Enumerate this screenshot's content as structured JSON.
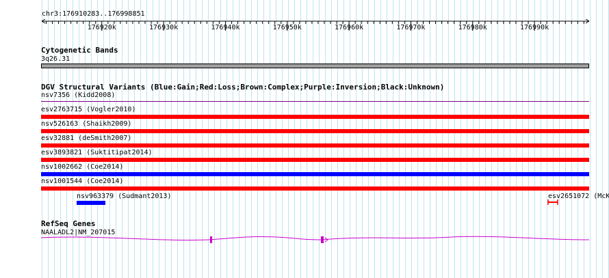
{
  "region": {
    "label": "chr3:176910283..176998851",
    "start": 176910283,
    "end": 176998851
  },
  "ruler": {
    "tick_labels": [
      "176920k",
      "176930k",
      "176940k",
      "176950k",
      "176960k",
      "176970k",
      "176980k",
      "176990k"
    ]
  },
  "cytobands": {
    "title": "Cytogenetic Bands",
    "band": "3q26.31",
    "color": "#a0a0a0"
  },
  "dgv": {
    "title": "DGV Structural Variants (Blue:Gain;Red:Loss;Brown:Complex;Purple:Inversion;Black:Unknown)",
    "colors": {
      "gain": "#0000ff",
      "loss": "#ff0000",
      "inversion": "#800080"
    },
    "variants": [
      {
        "label": "nsv7356 (Kidd2008)",
        "type": "inversion"
      },
      {
        "label": "esv2763715 (Vogler2010)",
        "type": "loss"
      },
      {
        "label": "nsv526163 (Shaikh2009)",
        "type": "loss"
      },
      {
        "label": "esv32881 (deSmith2007)",
        "type": "loss"
      },
      {
        "label": "esv3893821 (Suktitipat2014)",
        "type": "loss"
      },
      {
        "label": "nsv1002662 (Coe2014)",
        "type": "gain"
      },
      {
        "label": "nsv1001544 (Coe2014)",
        "type": "loss"
      }
    ],
    "small": [
      {
        "label": "nsv963379 (Sudmant2013)",
        "type": "gain"
      },
      {
        "label": "esv2651072 (McK",
        "type": "loss"
      }
    ]
  },
  "refseq": {
    "title": "RefSeq Genes",
    "gene": "NAALADL2|NM_207015",
    "color": "#cc00cc"
  }
}
